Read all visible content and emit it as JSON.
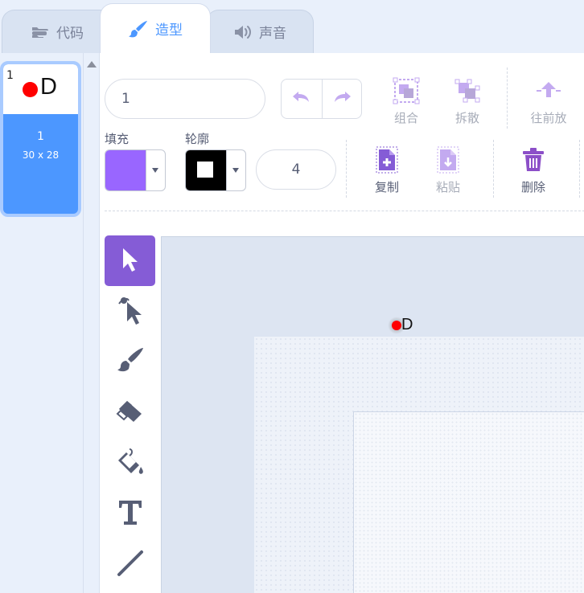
{
  "tabs": [
    {
      "label": "代码",
      "icon": "code-blocks-icon"
    },
    {
      "label": "造型",
      "icon": "paintbrush-icon"
    },
    {
      "label": "声音",
      "icon": "speaker-icon"
    }
  ],
  "active_tab": "造型",
  "costume_list": [
    {
      "index": "1",
      "thumb_letter": "D",
      "name": "1",
      "size": "30 x 28",
      "selected": true
    }
  ],
  "editor": {
    "costume_name_value": "1",
    "buttons": {
      "group": "组合",
      "ungroup": "拆散",
      "forward": "往前放",
      "copy": "复制",
      "paste": "粘贴",
      "delete": "删除"
    },
    "fill_label": "填充",
    "outline_label": "轮廓",
    "fill_color": "#9966ff",
    "outline_color": "#000000",
    "outline_width": "4",
    "tools": [
      {
        "name": "select",
        "icon": "arrow-pointer-icon",
        "active": true
      },
      {
        "name": "reshape",
        "icon": "reshape-pointer-icon",
        "active": false
      },
      {
        "name": "brush",
        "icon": "brush-icon",
        "active": false
      },
      {
        "name": "eraser",
        "icon": "eraser-icon",
        "active": false
      },
      {
        "name": "fill",
        "icon": "paint-bucket-icon",
        "active": false
      },
      {
        "name": "text",
        "icon": "text-icon",
        "active": false
      },
      {
        "name": "line",
        "icon": "line-icon",
        "active": false
      }
    ]
  },
  "canvas": {
    "sprite_letter": "D"
  },
  "colors": {
    "accent_blue": "#4c97ff",
    "accent_purple": "#855cd6",
    "delete_purple": "#8c4fc8",
    "sprite_red": "#ff0000"
  }
}
